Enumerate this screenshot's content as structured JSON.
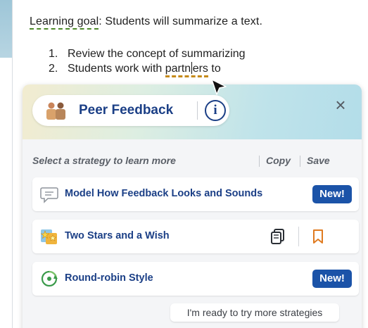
{
  "document": {
    "goal_prefix": "Learning goal",
    "goal_rest": ": Students will summarize a text.",
    "steps": [
      {
        "num": "1.",
        "text": "Review the concept of summarizing"
      },
      {
        "num": "2.",
        "text_before": "Students work with ",
        "highlight_a": "partn",
        "highlight_b": "ers",
        "text_after": " to"
      }
    ]
  },
  "panel": {
    "title": "Peer Feedback",
    "info_label": "i",
    "close_label": "×",
    "section_heading": "Select a strategy to learn more",
    "copy_label": "Copy",
    "save_label": "Save",
    "strategies": [
      {
        "label": "Model How Feedback Looks and Sounds",
        "badge": "New!",
        "icon": "speech-bubble-icon"
      },
      {
        "label": "Two Stars and a Wish",
        "icon": "stars-wish-icon"
      },
      {
        "label": "Round-robin Style",
        "badge": "New!",
        "icon": "round-robin-icon"
      }
    ],
    "more_button": "I'm ready to try more strategies"
  },
  "colors": {
    "accent": "#1b3f86",
    "badge": "#1b53a8",
    "goal_underline": "#4f8a2c",
    "partner_underline": "#c48a1a",
    "bookmark": "#e07b20"
  }
}
